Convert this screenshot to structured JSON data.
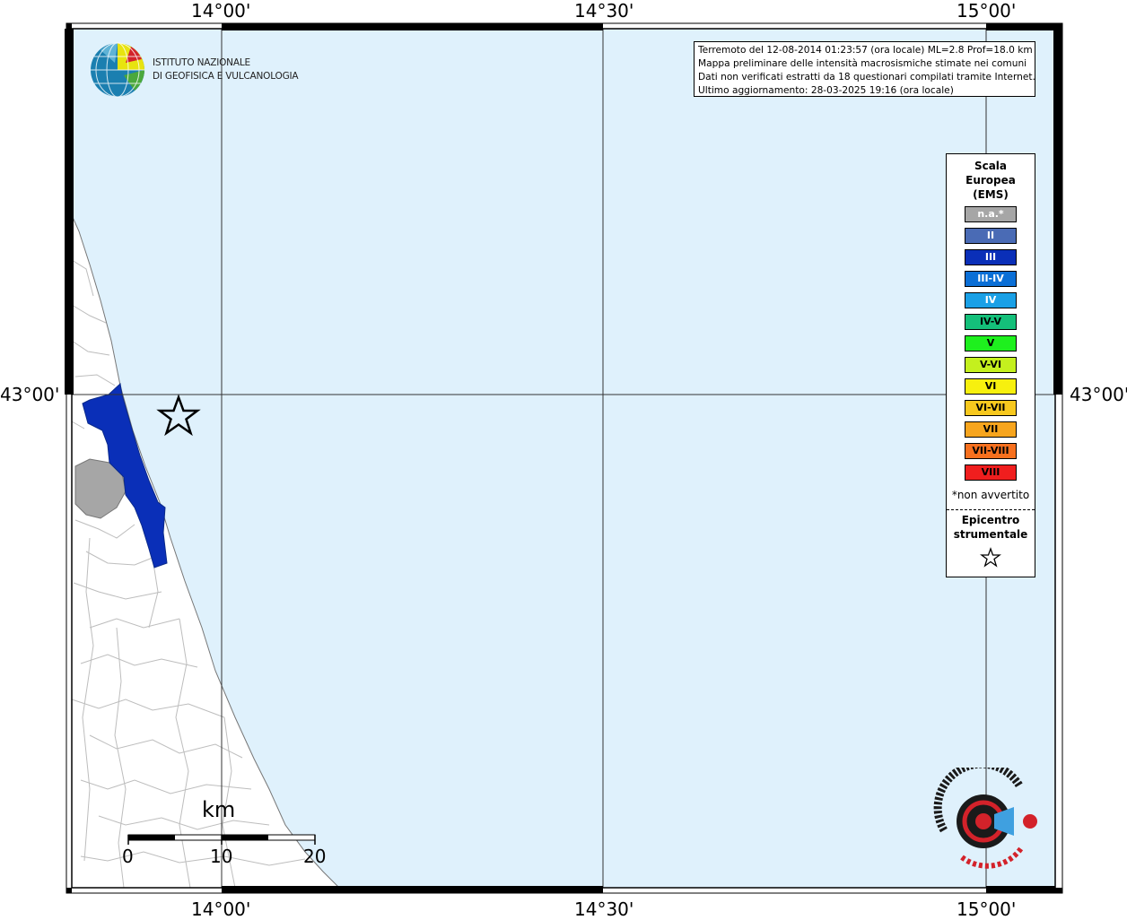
{
  "map": {
    "lon_labels": [
      "14°00'",
      "14°30'",
      "15°00'"
    ],
    "lat_labels": [
      "43°00'"
    ],
    "colors": {
      "sea": "#dff1fc",
      "land": "#ffffff",
      "intensity_III": "#0a2fb8",
      "not_available": "#a6a6a6"
    }
  },
  "logo": {
    "icon": "ingv-globe-icon",
    "lines": [
      "ISTITUTO NAZIONALE",
      "DI GEOFISICA E VULCANOLOGIA"
    ]
  },
  "info": {
    "lines": [
      "Terremoto del 12-08-2014 01:23:57 (ora locale) ML=2.8 Prof=18.0 km",
      "Mappa preliminare delle intensità macrosismiche stimate nei comuni",
      "Dati non verificati estratti da 18 questionari compilati tramite Internet.",
      "Ultimo aggiornamento: 28-03-2025 19:16 (ora locale)"
    ]
  },
  "legend": {
    "title_lines": [
      "Scala",
      "Europea",
      "(EMS)"
    ],
    "items": [
      {
        "label": "n.a.*",
        "color": "#a6a6a6",
        "text_color": "#ffffff"
      },
      {
        "label": "II",
        "color": "#4a6bb5",
        "text_color": "#ffffff"
      },
      {
        "label": "III",
        "color": "#0a2fb8",
        "text_color": "#ffffff"
      },
      {
        "label": "III-IV",
        "color": "#0b6fd6",
        "text_color": "#ffffff"
      },
      {
        "label": "IV",
        "color": "#1aa0e6",
        "text_color": "#ffffff"
      },
      {
        "label": "IV-V",
        "color": "#14c07a",
        "text_color": "#000000"
      },
      {
        "label": "V",
        "color": "#1ef01e",
        "text_color": "#000000"
      },
      {
        "label": "V-VI",
        "color": "#c4f01e",
        "text_color": "#000000"
      },
      {
        "label": "VI",
        "color": "#f7f00e",
        "text_color": "#000000"
      },
      {
        "label": "VI-VII",
        "color": "#f7c81e",
        "text_color": "#000000"
      },
      {
        "label": "VII",
        "color": "#f7a51e",
        "text_color": "#000000"
      },
      {
        "label": "VII-VIII",
        "color": "#f7701e",
        "text_color": "#000000"
      },
      {
        "label": "VIII",
        "color": "#f01e1e",
        "text_color": "#000000"
      }
    ],
    "note": "*non avvertito",
    "epicenter_lines": [
      "Epicentro",
      "strumentale"
    ],
    "epicenter_icon": "star-icon"
  },
  "scale_bar": {
    "unit": "km",
    "ticks": [
      "0",
      "10",
      "20"
    ]
  },
  "brand": {
    "icon": "haisentitoilterremoto-logo-icon"
  }
}
